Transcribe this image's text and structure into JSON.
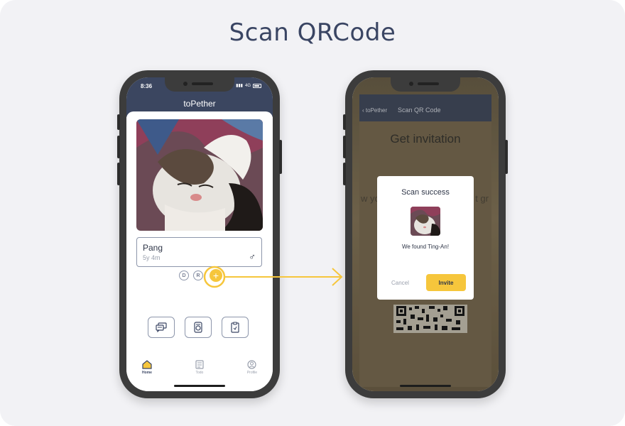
{
  "page": {
    "title": "Scan QRCode"
  },
  "left_phone": {
    "status_time": "8:36",
    "status_network": "4G",
    "app_title": "toPether",
    "pet": {
      "name": "Pang",
      "age": "5y  4m",
      "gender_symbol": "♂"
    },
    "chips": [
      "D",
      "R"
    ],
    "add_symbol": "+",
    "tabs": [
      {
        "label": "Home",
        "icon": "home-icon",
        "active": true
      },
      {
        "label": "Todo",
        "icon": "todo-icon",
        "active": false
      },
      {
        "label": "Profile",
        "icon": "profile-icon",
        "active": false
      }
    ]
  },
  "right_phone": {
    "back_label": "toPether",
    "screen_title": "Scan QR Code",
    "heading": "Get invitation",
    "bg_text_left": "w yo",
    "bg_text_right": "t gr",
    "modal": {
      "title": "Scan success",
      "message": "We found Ting-An!",
      "cancel_label": "Cancel",
      "invite_label": "Invite"
    }
  },
  "colors": {
    "accent": "#f6c63c",
    "header": "#3b4660",
    "title": "#3a4563"
  }
}
